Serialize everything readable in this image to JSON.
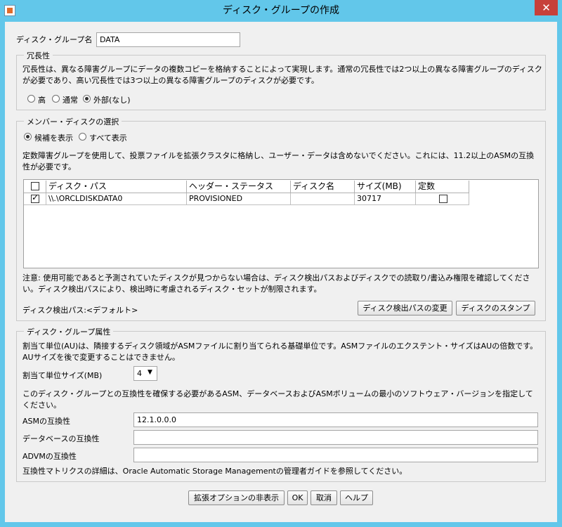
{
  "window": {
    "title": "ディスク・グループの作成"
  },
  "disk_group_name": {
    "label": "ディスク・グループ名",
    "value": "DATA"
  },
  "redundancy": {
    "legend": "冗長性",
    "desc_line1": "冗長性は、異なる障害グループにデータの複数コピーを格納することによって実現します。通常の冗長性では2つ以上の異なる障害グループのディスク",
    "desc_line2": "が必要であり、高い冗長性では3つ以上の異なる障害グループのディスクが必要です。",
    "options": [
      "高",
      "通常",
      "外部(なし)"
    ],
    "selected": "外部(なし)"
  },
  "member_disks": {
    "legend": "メンバー・ディスクの選択",
    "filter_options": [
      "候補を表示",
      "すべて表示"
    ],
    "filter_selected": "候補を表示",
    "note_line1": "定数障害グループを使用して、投票ファイルを拡張クラスタに格納し、ユーザー・データは含めないでください。これには、11.2以上のASMの互換",
    "note_line2": "性が必要です。",
    "table": {
      "headers": [
        "ディスク・パス",
        "ヘッダー・ステータス",
        "ディスク名",
        "サイズ(MB)",
        "定数"
      ],
      "rows": [
        {
          "checked": true,
          "path": "\\\\.\\ORCLDISKDATA0",
          "status": "PROVISIONED",
          "name": "",
          "size": "30717",
          "quorum": false
        }
      ]
    },
    "warn_line1": "注意: 使用可能であると予測されていたディスクが見つからない場合は、ディスク検出パスおよびディスクでの読取り/書込み権限を確認してくださ",
    "warn_line2": "い。ディスク検出パスにより、検出時に考慮されるディスク・セットが制限されます。",
    "discovery_path_label": "ディスク検出パス:<デフォルト>",
    "change_path_button": "ディスク検出パスの変更",
    "stamp_button": "ディスクのスタンプ"
  },
  "attributes": {
    "legend": "ディスク・グループ属性",
    "au_desc_line1": "割当て単位(AU)は、隣接するディスク領域がASMファイルに割り当てられる基礎単位です。ASMファイルのエクステント・サイズはAUの倍数です。",
    "au_desc_line2": "AUサイズを後で変更することはできません。",
    "au_size_label": "割当て単位サイズ(MB)",
    "au_size_value": "4",
    "compat_desc_line1": "このディスク・グループとの互換性を確保する必要があるASM、データベースおよびASMボリュームの最小のソフトウェア・バージョンを指定して",
    "compat_desc_line2": "ください。",
    "asm_compat_label": "ASMの互換性",
    "asm_compat_value": "12.1.0.0.0",
    "db_compat_label": "データベースの互換性",
    "db_compat_value": "",
    "advm_compat_label": "ADVMの互換性",
    "advm_compat_value": "",
    "matrix_note": "互換性マトリクスの詳細は、Oracle Automatic Storage Managementの管理者ガイドを参照してください。"
  },
  "footer": {
    "advanced_button": "拡張オプションの非表示",
    "ok_button": "OK",
    "cancel_button": "取消",
    "help_button": "ヘルプ"
  }
}
